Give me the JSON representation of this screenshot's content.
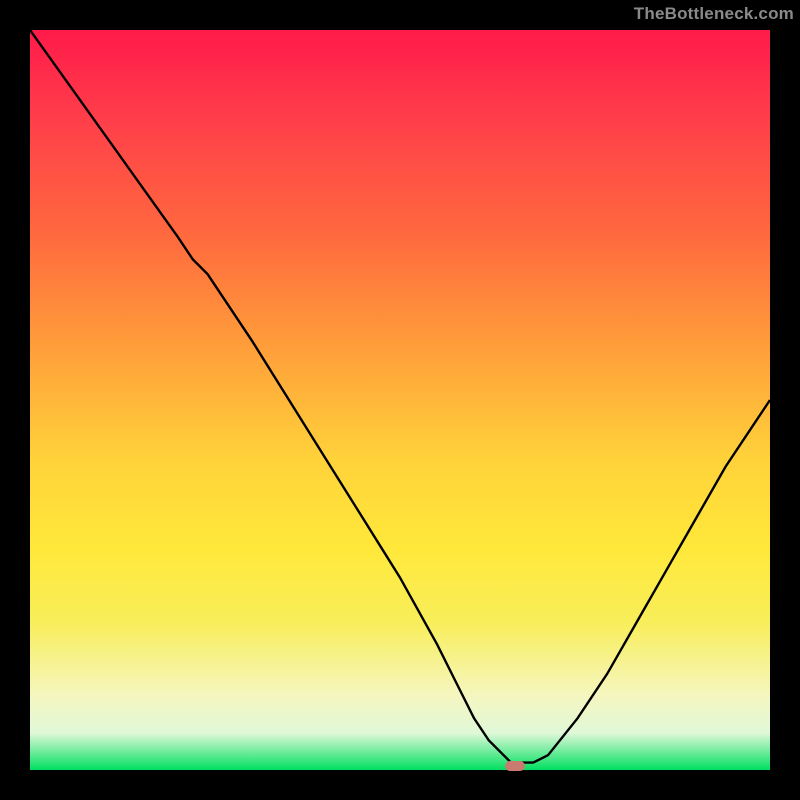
{
  "watermark": "TheBottleneck.com",
  "marker": {
    "x_norm": 0.655,
    "y_norm": 0.994,
    "color": "#c97b70"
  },
  "chart_data": {
    "type": "line",
    "title": "",
    "xlabel": "",
    "ylabel": "",
    "xlim": [
      0,
      1
    ],
    "ylim": [
      0,
      1
    ],
    "x": [
      0.0,
      0.05,
      0.1,
      0.15,
      0.2,
      0.22,
      0.24,
      0.3,
      0.35,
      0.4,
      0.45,
      0.5,
      0.55,
      0.58,
      0.6,
      0.62,
      0.65,
      0.68,
      0.7,
      0.74,
      0.78,
      0.82,
      0.86,
      0.9,
      0.94,
      0.98,
      1.0
    ],
    "y": [
      1.0,
      0.93,
      0.86,
      0.79,
      0.72,
      0.69,
      0.67,
      0.58,
      0.5,
      0.42,
      0.34,
      0.26,
      0.17,
      0.11,
      0.07,
      0.04,
      0.01,
      0.01,
      0.02,
      0.07,
      0.13,
      0.2,
      0.27,
      0.34,
      0.41,
      0.47,
      0.5
    ],
    "series_marker": {
      "x": 0.655,
      "y": 0.006
    },
    "grid": false,
    "legend": false
  }
}
